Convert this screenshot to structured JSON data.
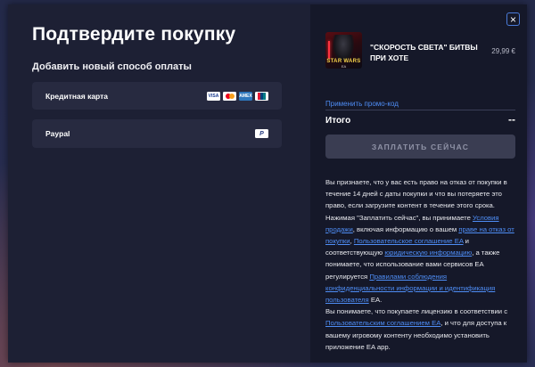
{
  "purchase": {
    "title": "Подтвердите покупку",
    "subtitle": "Добавить новый способ оплаты",
    "methods": [
      {
        "label": "Кредитная карта",
        "logos": [
          "visa-icon",
          "mastercard-icon",
          "amex-icon",
          "unionpay-icon"
        ]
      },
      {
        "label": "Paypal",
        "logos": [
          "paypal-icon"
        ]
      }
    ],
    "logo_text": {
      "visa": "VISA",
      "amex": "AMEX",
      "paypal": "P"
    }
  },
  "summary": {
    "close_icon": "×",
    "game": {
      "name": "\"СКОРОСТЬ СВЕТА\" БИТВЫ ПРИ ХОТЕ",
      "price": "29,99 €",
      "cover_text": "STAR WARS",
      "cover_sub": "EA"
    },
    "promo_link": "Применить промо-код",
    "total_label": "Итого",
    "total_value": "--",
    "pay_button": "ЗАПЛАТИТЬ СЕЙЧАС"
  },
  "legal": {
    "p1_a": "Вы признаете, что у вас есть право на отказ от покупки в течение 14 дней с даты покупки и что вы потеряете это право, если загрузите контент в течение этого срока. Нажимая \"Заплатить сейчас\", вы принимаете ",
    "link_terms": "Условия продажи",
    "p1_b": ", включая информацию о вашем ",
    "link_withdrawal": "праве на отказ от покупки",
    "p1_c": ", ",
    "link_user_agreement": "Пользовательское соглашение EA",
    "p1_d": " и соответствующую ",
    "link_legal_info": "юридическую информацию",
    "p1_e": ", а также понимаете, что использование вами сервисов EA регулируется ",
    "link_privacy": "Правилами соблюдения конфиденциальности информации и идентификация пользователя",
    "p1_f": " EA.",
    "p2_a": "Вы понимаете, что покупаете лицензию в соответствии с ",
    "link_user_agreement2": "Пользовательским соглашением EA",
    "p2_b": ", и что для доступа к вашему игровому контенту необходимо установить приложение EA app."
  },
  "colors": {
    "accent": "#4e8df5",
    "left_panel": "#1d2034",
    "right_panel": "#151829"
  }
}
